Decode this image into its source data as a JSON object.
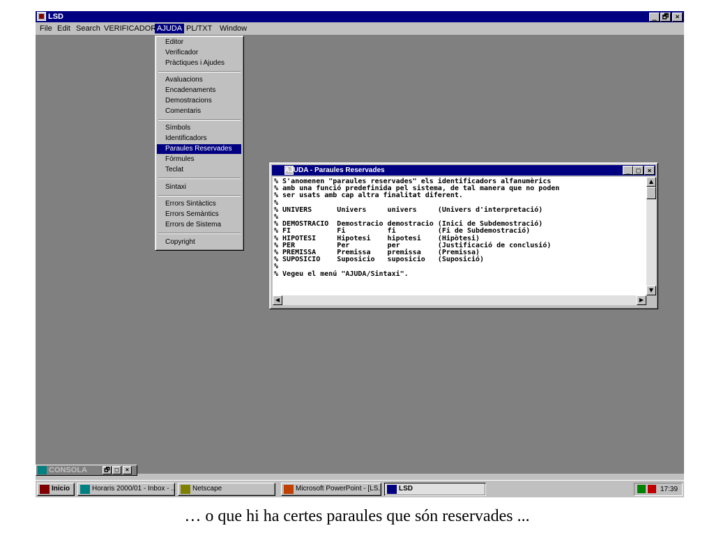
{
  "window": {
    "title": "LSD",
    "min": "_",
    "max": "🗗",
    "close": "×"
  },
  "menubar": {
    "items": [
      "File",
      "Edit",
      "Search",
      "VERIFICADOR",
      "AJUDA",
      "PL/TXT",
      "Window"
    ],
    "active": "AJUDA"
  },
  "ajuda_menu": {
    "items": [
      "Editor",
      "Verificador",
      "Pràctiques i Ajudes",
      "Avaluacions",
      "Encadenaments",
      "Demostracions",
      "Comentaris",
      "Símbols",
      "Identificadors",
      "Paraules Reservades",
      "Fórmules",
      "Teclat",
      "Sintaxi",
      "Errors Sintàctics",
      "Errors Semàntics",
      "Errors de Sistema",
      "Copyright"
    ],
    "selected": "Paraules Reservades"
  },
  "help_window": {
    "title": "AJUDA - Paraules Reservades",
    "lines": [
      "% S'anomenen \"paraules reservades\" els identificadors alfanumèrics",
      "% amb una funció predefinida pel sistema, de tal manera que no poden",
      "% ser usats amb cap altra finalitat diferent.",
      "%",
      "% UNIVERS      Univers     univers     (Univers d'interpretació)",
      "%",
      "% DEMOSTRACIO  Demostracio demostracio (Inici de Subdemostració)",
      "% FI           Fi          fi          (Fi de Subdemostració)",
      "% HIPOTESI     Hipotesi    hipotesi    (Hipòtesi)",
      "% PER          Per         per         (Justificació de conclusió)",
      "% PREMISSA     Premissa    premissa    (Premissa)",
      "% SUPOSICIO    Suposicio   suposicio   (Suposició)",
      "%",
      "% Vegeu el menú \"AJUDA/Sintaxi\"."
    ]
  },
  "minimized_window": {
    "title": "CONSOLA"
  },
  "taskbar": {
    "start": "Inicio",
    "buttons": [
      "Horaris 2000/01 - Inbox - ...",
      "Netscape",
      "Microsoft PowerPoint - [LS...",
      "LSD"
    ],
    "active": "LSD",
    "clock": "17:39"
  },
  "caption": "… o que hi ha certes paraules que són reservades ..."
}
